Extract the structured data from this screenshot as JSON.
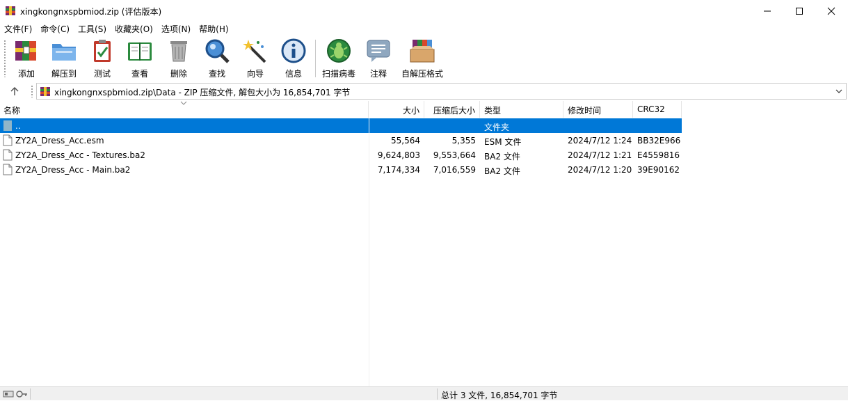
{
  "window": {
    "title": "xingkongnxspbmiod.zip (评估版本)",
    "icon": "winrar-archive-icon"
  },
  "menu": [
    "文件(F)",
    "命令(C)",
    "工具(S)",
    "收藏夹(O)",
    "选项(N)",
    "帮助(H)"
  ],
  "toolbar": {
    "buttons": [
      {
        "label": "添加",
        "icon": "add-archive-icon"
      },
      {
        "label": "解压到",
        "icon": "extract-folder-icon"
      },
      {
        "label": "测试",
        "icon": "test-clipboard-icon"
      },
      {
        "label": "查看",
        "icon": "view-book-icon"
      },
      {
        "label": "删除",
        "icon": "trash-icon"
      },
      {
        "label": "查找",
        "icon": "magnifier-icon"
      },
      {
        "label": "向导",
        "icon": "wizard-wand-icon"
      },
      {
        "label": "信息",
        "icon": "info-icon"
      },
      {
        "label": "扫描病毒",
        "icon": "virus-scan-icon"
      },
      {
        "label": "注释",
        "icon": "comment-icon"
      },
      {
        "label": "自解压格式",
        "icon": "sfx-box-icon"
      }
    ]
  },
  "address": {
    "path": "xingkongnxspbmiod.zip\\Data - ZIP 压缩文件, 解包大小为 16,854,701 字节"
  },
  "columns": {
    "name": "名称",
    "size": "大小",
    "packed": "压缩后大小",
    "type": "类型",
    "modified": "修改时间",
    "crc": "CRC32"
  },
  "rows": [
    {
      "name": "..",
      "size": "",
      "packed": "",
      "type": "文件夹",
      "modified": "",
      "crc": "",
      "selected": true
    },
    {
      "name": "ZY2A_Dress_Acc.esm",
      "size": "55,564",
      "packed": "5,355",
      "type": "ESM 文件",
      "modified": "2024/7/12 1:24",
      "crc": "BB32E966"
    },
    {
      "name": "ZY2A_Dress_Acc - Textures.ba2",
      "size": "9,624,803",
      "packed": "9,553,664",
      "type": "BA2 文件",
      "modified": "2024/7/12 1:21",
      "crc": "E4559816"
    },
    {
      "name": "ZY2A_Dress_Acc - Main.ba2",
      "size": "7,174,334",
      "packed": "7,016,559",
      "type": "BA2 文件",
      "modified": "2024/7/12 1:20",
      "crc": "39E90162"
    }
  ],
  "status": {
    "summary": "总计 3 文件, 16,854,701 字节"
  },
  "colors": {
    "selection": "#0078d7"
  }
}
